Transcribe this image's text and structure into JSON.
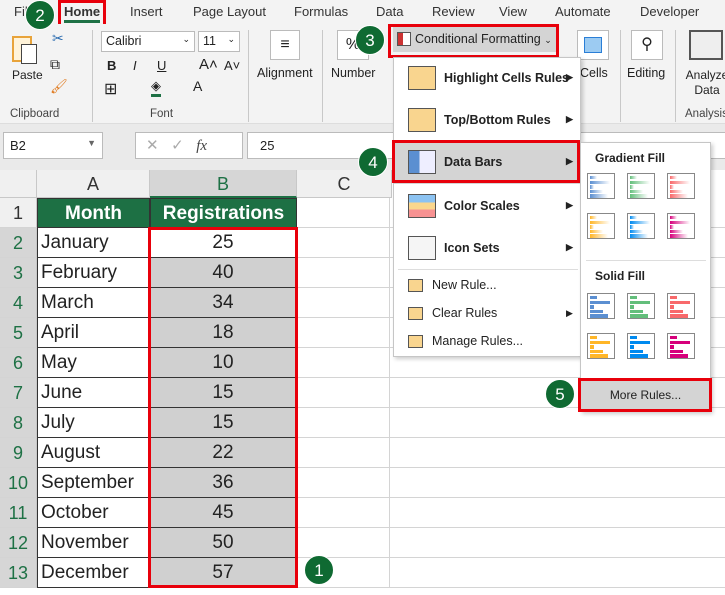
{
  "tabs": [
    "File",
    "Home",
    "Insert",
    "Page Layout",
    "Formulas",
    "Data",
    "Review",
    "View",
    "Automate",
    "Developer"
  ],
  "ribbon": {
    "paste": "Paste",
    "clipboard": "Clipboard",
    "font_name": "Calibri",
    "font_size": "11",
    "font": "Font",
    "alignment": "Alignment",
    "number": "Number",
    "number_icon": "%",
    "conditional_formatting": "Conditional Formatting",
    "cells": "Cells",
    "editing": "Editing",
    "analyze_data": "Analyze Data",
    "analysis": "Analysis",
    "bold": "B",
    "italic": "I",
    "underline": "U"
  },
  "formula_bar": {
    "name_box": "B2",
    "fx": "fx",
    "value": "25"
  },
  "columns": [
    "A",
    "B",
    "C"
  ],
  "headers": [
    "Month",
    "Registrations"
  ],
  "rows": [
    [
      "January",
      "25"
    ],
    [
      "February",
      "40"
    ],
    [
      "March",
      "34"
    ],
    [
      "April",
      "18"
    ],
    [
      "May",
      "10"
    ],
    [
      "June",
      "15"
    ],
    [
      "July",
      "15"
    ],
    [
      "August",
      "22"
    ],
    [
      "September",
      "36"
    ],
    [
      "October",
      "45"
    ],
    [
      "November",
      "50"
    ],
    [
      "December",
      "57"
    ]
  ],
  "row_numbers": [
    "1",
    "2",
    "3",
    "4",
    "5",
    "6",
    "7",
    "8",
    "9",
    "10",
    "11",
    "12",
    "13"
  ],
  "menu": {
    "items": [
      "Highlight Cells Rules",
      "Top/Bottom Rules",
      "Data Bars",
      "Color Scales",
      "Icon Sets"
    ],
    "small_items": [
      "New Rule...",
      "Clear Rules",
      "Manage Rules..."
    ]
  },
  "submenu": {
    "gradient_title": "Gradient Fill",
    "solid_title": "Solid Fill",
    "more_rules": "More Rules...",
    "bar_colors": [
      "#5b8fd1",
      "#63be7b",
      "#f8696b",
      "#ffb628",
      "#008aef",
      "#d6007b"
    ]
  },
  "steps": [
    "1",
    "2",
    "3",
    "4",
    "5"
  ],
  "colors": {
    "header_bg": "#1d7044",
    "selection": "#d0d0d0",
    "highlight": "#e8000b",
    "step_circle": "#0f6a32"
  }
}
